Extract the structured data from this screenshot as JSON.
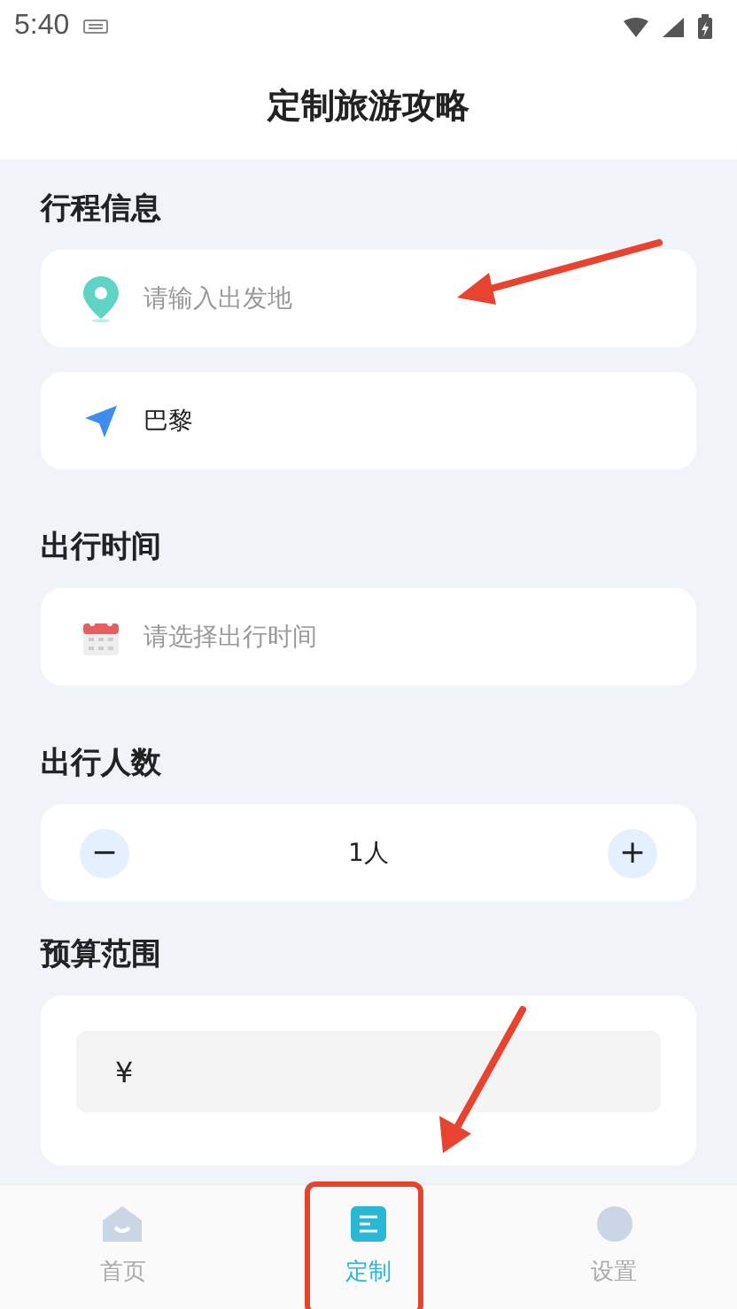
{
  "status_bar": {
    "time": "5:40"
  },
  "header": {
    "title": "定制旅游攻略"
  },
  "sections": [
    {
      "title": "行程信息",
      "fields": [
        {
          "kind": "pin",
          "placeholder": "请输入出发地"
        },
        {
          "kind": "arrow",
          "value": "巴黎"
        }
      ]
    },
    {
      "title": "出行时间",
      "fields": [
        {
          "kind": "calendar",
          "placeholder": "请选择出行时间"
        }
      ]
    },
    {
      "title": "出行人数",
      "stepper": {
        "minus": "−",
        "value": "1人",
        "plus": "+"
      }
    },
    {
      "title": "预算范围",
      "budget": {
        "prefix": "¥"
      }
    }
  ],
  "tabs": [
    {
      "label": "首页",
      "selected": false
    },
    {
      "label": "定制",
      "selected": true
    },
    {
      "label": "设置",
      "selected": false
    }
  ]
}
